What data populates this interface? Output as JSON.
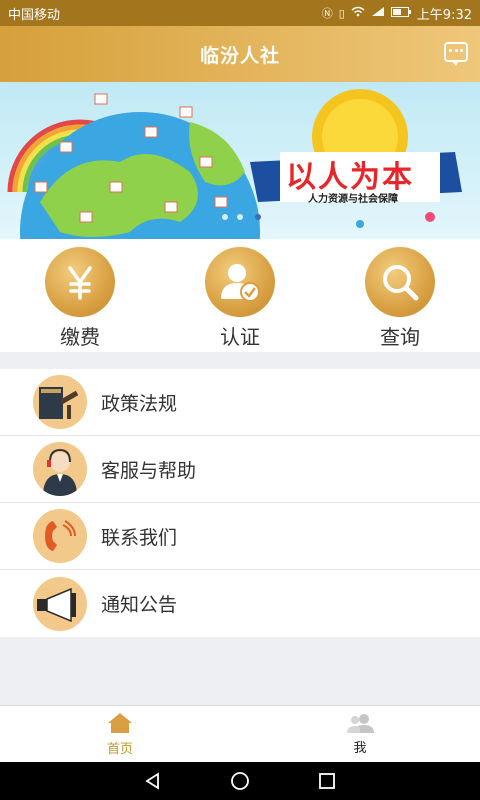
{
  "status": {
    "carrier": "中国移动",
    "time": "上午9:32"
  },
  "header": {
    "title": "临汾人社"
  },
  "banner": {
    "slogan": "以人为本",
    "subtitle": "人力资源与社会保障"
  },
  "quick_actions": [
    {
      "label": "缴费",
      "icon": "yuan-icon"
    },
    {
      "label": "认证",
      "icon": "user-verify-icon"
    },
    {
      "label": "查询",
      "icon": "search-icon"
    }
  ],
  "menu": [
    {
      "label": "政策法规",
      "icon": "law-book-icon"
    },
    {
      "label": "客服与帮助",
      "icon": "customer-service-icon"
    },
    {
      "label": "联系我们",
      "icon": "phone-icon"
    },
    {
      "label": "通知公告",
      "icon": "megaphone-icon"
    }
  ],
  "tabs": [
    {
      "label": "首页",
      "active": true
    },
    {
      "label": "我",
      "active": false
    }
  ],
  "colors": {
    "accent": "#d9a043",
    "active_tab": "#c9952c"
  }
}
